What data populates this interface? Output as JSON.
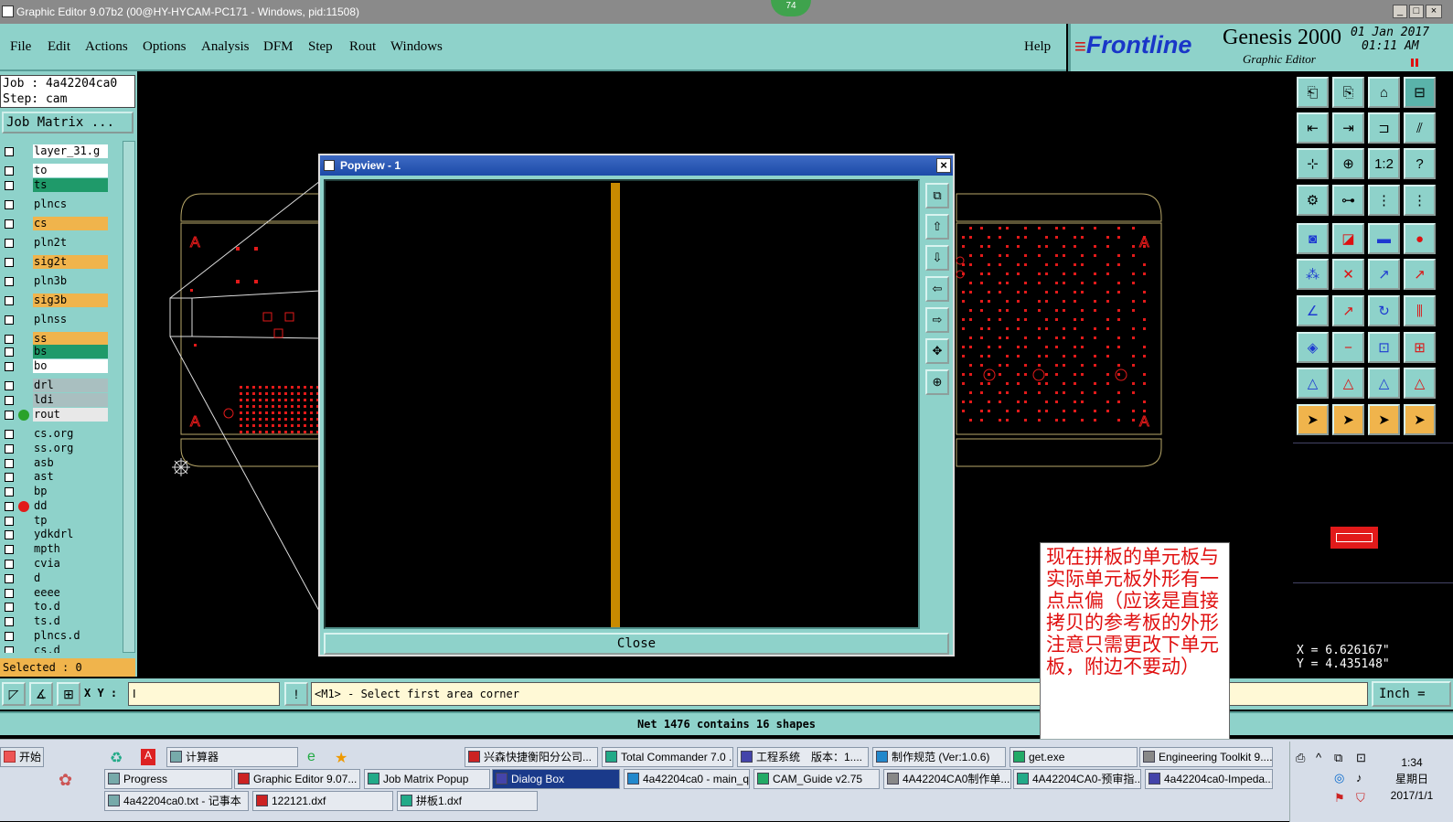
{
  "window": {
    "title": "Graphic Editor 9.07b2 (00@HY-HYCAM-PC171 - Windows, pid:11508)",
    "badge": "74",
    "min": "_",
    "max": "□",
    "close": "×"
  },
  "menu": {
    "file": "File",
    "edit": "Edit",
    "actions": "Actions",
    "options": "Options",
    "analysis": "Analysis",
    "dfm": "DFM",
    "step": "Step",
    "rout": "Rout",
    "windows": "Windows",
    "help": "Help"
  },
  "brand": {
    "logo": "Frontline",
    "product": "Genesis 2000",
    "subtitle": "Graphic Editor",
    "date": "01 Jan 2017",
    "time": "01:11 AM"
  },
  "job": {
    "job_line": "Job : 4a42204ca0",
    "step_line": "Step: cam",
    "job_matrix": "Job Matrix ..."
  },
  "layers": [
    {
      "name": "layer_31.g",
      "color": "#ffffff"
    },
    {
      "name": "to",
      "color": "#ffffff"
    },
    {
      "name": "ts",
      "color": "#1f9a6a"
    },
    {
      "name": "plncs",
      "color": "#8ed2ca"
    },
    {
      "name": "cs",
      "color": "#f0b44c"
    },
    {
      "name": "pln2t",
      "color": "#8ed2ca"
    },
    {
      "name": "sig2t",
      "color": "#f0b44c"
    },
    {
      "name": "pln3b",
      "color": "#8ed2ca"
    },
    {
      "name": "sig3b",
      "color": "#f0b44c"
    },
    {
      "name": "plnss",
      "color": "#8ed2ca"
    },
    {
      "name": "ss",
      "color": "#f0b44c"
    },
    {
      "name": "bs",
      "color": "#1f9a6a"
    },
    {
      "name": "bo",
      "color": "#ffffff"
    },
    {
      "name": "drl",
      "color": "#a9bfc0"
    },
    {
      "name": "ldi",
      "color": "#a9bfc0"
    },
    {
      "name": "rout",
      "color": "#e8e8e8"
    },
    {
      "name": "cs.org",
      "color": "#8ed2ca"
    },
    {
      "name": "ss.org",
      "color": "#8ed2ca"
    },
    {
      "name": "asb",
      "color": "#8ed2ca"
    },
    {
      "name": "ast",
      "color": "#8ed2ca"
    },
    {
      "name": "bp",
      "color": "#8ed2ca"
    },
    {
      "name": "dd",
      "color": "#8ed2ca"
    },
    {
      "name": "tp",
      "color": "#8ed2ca"
    },
    {
      "name": "ydkdrl",
      "color": "#8ed2ca"
    },
    {
      "name": "mpth",
      "color": "#8ed2ca"
    },
    {
      "name": "cvia",
      "color": "#8ed2ca"
    },
    {
      "name": "d",
      "color": "#8ed2ca"
    },
    {
      "name": "eeee",
      "color": "#8ed2ca"
    },
    {
      "name": "to.d",
      "color": "#8ed2ca"
    },
    {
      "name": "ts.d",
      "color": "#8ed2ca"
    },
    {
      "name": "plncs.d",
      "color": "#8ed2ca"
    },
    {
      "name": "cs.d",
      "color": "#8ed2ca"
    }
  ],
  "selected": "Selected : 0",
  "popview": {
    "title": "Popview - 1",
    "close": "Close"
  },
  "command": {
    "xy_label": "X Y :",
    "prompt": "<M1> - Select first area corner",
    "unit": "Inch"
  },
  "status": "Net 1476 contains 16 shapes",
  "coords": {
    "x": "X = 6.626167\"",
    "y": "Y = 4.435148\""
  },
  "note": "现在拼板的单元板与实际单元板外形有一点点偏（应该是直接拷贝的参考板的外形　注意只需更改下单元板，附边不要动）",
  "taskbar": {
    "start": "开始",
    "row1": [
      "计算器",
      "兴森快捷衡阳分公司...",
      "Total Commander 7.0 ...",
      "工程系统　版本：1....",
      "制作规范 (Ver:1.0.6)",
      "get.exe",
      "Engineering Toolkit 9...."
    ],
    "row2": [
      "Progress",
      "Graphic Editor 9.07...",
      "Job Matrix Popup",
      "Dialog Box",
      "4a42204ca0 - main_qa",
      "CAM_Guide v2.75",
      "4A42204CA0制作单....",
      "4A42204CA0-预审指...",
      "4a42204ca0-Impeda..."
    ],
    "row3": [
      "4a42204ca0.txt - 记事本",
      "122121.dxf",
      "拼板1.dxf"
    ],
    "clock_time": "1:34",
    "clock_day": "星期日",
    "clock_date": "2017/1/1"
  }
}
